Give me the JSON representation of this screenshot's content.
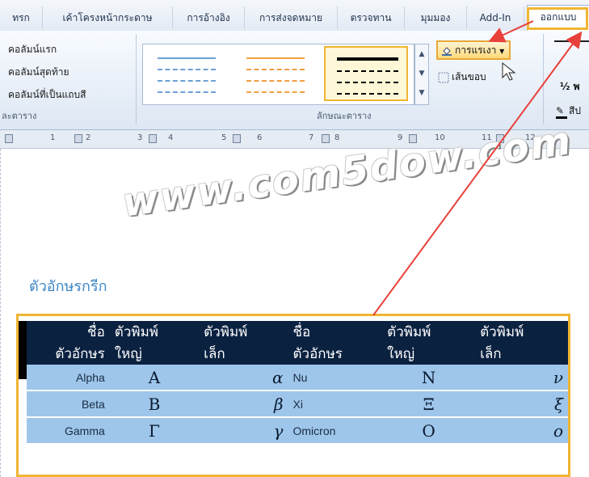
{
  "tabs": [
    {
      "label": "ทรก"
    },
    {
      "label": "เค้าโครงหน้ากระดาษ"
    },
    {
      "label": "การอ้างอิง"
    },
    {
      "label": "การส่งจดหมาย"
    },
    {
      "label": "ตรวจทาน"
    },
    {
      "label": "มุมมอง"
    },
    {
      "label": "Add-In"
    },
    {
      "label": "ออกแบบ"
    }
  ],
  "style_options": {
    "first_column": "คอลัมน์แรก",
    "last_column": "คอลัมน์สุดท้าย",
    "banded_columns": "คอลัมน์ที่เป็นแถบสี",
    "group_label": "ละตาราง"
  },
  "table_styles": {
    "group_label": "ลักษณะตาราง",
    "shading_label": "การแรเงา",
    "borders_label": "เส้นขอบ",
    "pen_weight": "½ พ",
    "pen_color": "สีป"
  },
  "ruler": {
    "numbers": [
      "1",
      "2",
      "3",
      "4",
      "5",
      "6",
      "7",
      "8",
      "9",
      "10",
      "11",
      "12"
    ]
  },
  "document": {
    "watermark": "www.com5dow.com",
    "heading": "ตัวอักษรกรีก"
  },
  "greek_table": {
    "headers": [
      [
        "ชื่อ",
        "ตัวอักษร"
      ],
      [
        "ตัวพิมพ์",
        "ใหญ่"
      ],
      [
        "ตัวพิมพ์",
        "เล็ก"
      ],
      [
        "ชื่อ",
        "ตัวอักษร"
      ],
      [
        "ตัวพิมพ์",
        "ใหญ่"
      ],
      [
        "ตัวพิมพ์",
        "เล็ก"
      ]
    ],
    "rows": [
      [
        "Alpha",
        "Α",
        "α",
        "Nu",
        "Ν",
        "ν"
      ],
      [
        "Beta",
        "Β",
        "β",
        "Xi",
        "Ξ",
        "ξ"
      ],
      [
        "Gamma",
        "Γ",
        "γ",
        "Omicron",
        "Ο",
        "ο"
      ]
    ]
  },
  "colors": {
    "highlight": "#f0b533",
    "arrow": "#e8403a",
    "table_header": "#0b2140",
    "table_row": "#9ec6ea",
    "heading": "#3d86c6"
  }
}
